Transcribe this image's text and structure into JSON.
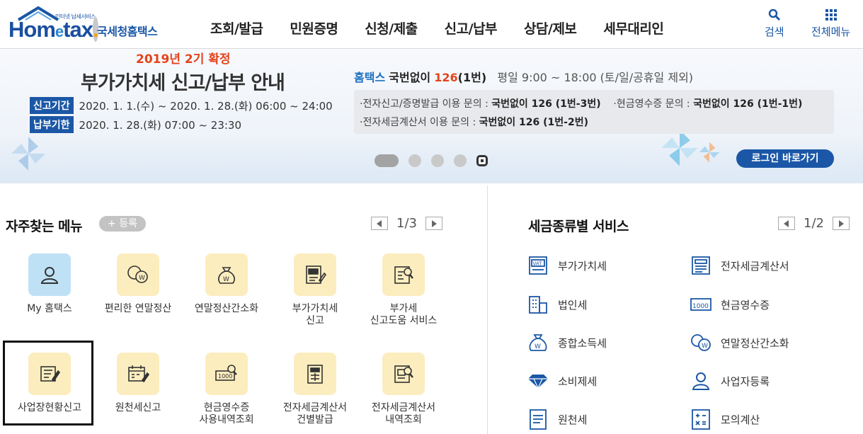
{
  "header": {
    "logo_tagline": "인터넷 납세서비스",
    "logo_brand_a": "Hom",
    "logo_brand_e": "e",
    "logo_brand_b": "tax",
    "logo_org": "국세청홈택스",
    "nav": [
      "조회/발급",
      "민원증명",
      "신청/제출",
      "신고/납부",
      "상담/제보",
      "세무대리인"
    ],
    "search_label": "검색",
    "allmenu_label": "전체메뉴",
    "accent": "#1b57a6"
  },
  "banner": {
    "subtitle": "2019년 2기 확정",
    "title": "부가가치세 신고/납부 안내",
    "periods": [
      {
        "badge": "신고기간",
        "text": "2020. 1. 1.(수) ~ 2020. 1. 28.(화) 06:00 ~ 24:00"
      },
      {
        "badge": "납부기한",
        "text": "2020. 1. 28.(화) 07:00 ~ 23:30"
      }
    ],
    "contact": {
      "org": "홈택스",
      "no_area": "국번없이",
      "number": "126",
      "number_suffix": "(1번)",
      "hours": "평일 9:00 ~ 18:00 (토/일/공휴일 제외)",
      "lines": [
        {
          "a": "·전자신고/증명발급 이용 문의 : ",
          "b": "국번없이 126 (1번-3번)",
          "c": "·현금영수증 문의 : ",
          "d": "국번없이 126 (1번-1번)"
        },
        {
          "a": "·전자세금계산서 이용 문의 : ",
          "b": "국번없이 126 (1번-2번)"
        }
      ]
    },
    "login_shortcut": "로그인 바로가기"
  },
  "favorites": {
    "title": "자주찾는 메뉴",
    "register": "+ 등록",
    "page": "1/3",
    "items": [
      {
        "label": "My 홈택스",
        "icon": "person-icon"
      },
      {
        "label": "편리한 연말정산",
        "icon": "coin-icon"
      },
      {
        "label": "연말정산간소화",
        "icon": "money-bag-icon"
      },
      {
        "label": "부가가치세\n신고",
        "icon": "vat-doc-icon"
      },
      {
        "label": "부가세\n신고도움 서비스",
        "icon": "doc-search-icon"
      },
      {
        "label": "사업장현황신고",
        "icon": "doc-pen-icon"
      },
      {
        "label": "원천세신고",
        "icon": "calendar-pen-icon"
      },
      {
        "label": "현금영수증\n사용내역조회",
        "icon": "receipt-search-icon"
      },
      {
        "label": "전자세금계산서\n건별발급",
        "icon": "calculator-doc-icon"
      },
      {
        "label": "전자세금계산서\n내역조회",
        "icon": "doc-search-icon"
      }
    ]
  },
  "tax_services": {
    "title": "세금종류별 서비스",
    "page": "1/2",
    "items": [
      {
        "label": "부가가치세",
        "icon": "vat-icon"
      },
      {
        "label": "전자세금계산서",
        "icon": "invoice-icon"
      },
      {
        "label": "법인세",
        "icon": "building-icon"
      },
      {
        "label": "현금영수증",
        "icon": "cash-receipt-icon"
      },
      {
        "label": "종합소득세",
        "icon": "money-bag-icon"
      },
      {
        "label": "연말정산간소화",
        "icon": "coin-icon"
      },
      {
        "label": "소비제세",
        "icon": "diamond-icon"
      },
      {
        "label": "사업자등록",
        "icon": "person-icon"
      },
      {
        "label": "원천세",
        "icon": "doc-icon"
      },
      {
        "label": "모의계산",
        "icon": "calculator-icon"
      }
    ]
  }
}
